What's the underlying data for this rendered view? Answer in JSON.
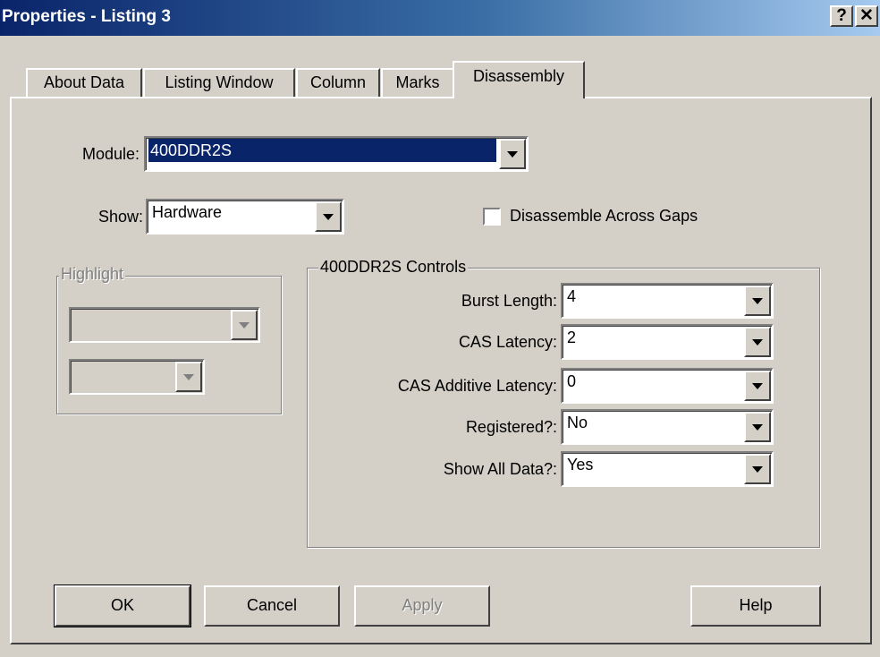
{
  "window": {
    "title": "Properties - Listing 3",
    "help_caption": "?",
    "close_caption": "✕"
  },
  "tabs": [
    {
      "label": "About Data",
      "selected": false
    },
    {
      "label": "Listing Window",
      "selected": false
    },
    {
      "label": "Column",
      "selected": false
    },
    {
      "label": "Marks",
      "selected": false
    },
    {
      "label": "Disassembly",
      "selected": true
    }
  ],
  "module": {
    "label": "Module:",
    "value": "400DDR2S"
  },
  "show": {
    "label": "Show:",
    "value": "Hardware"
  },
  "disassemble_gaps": {
    "label": "Disassemble Across Gaps",
    "checked": false
  },
  "highlight": {
    "title": "Highlight",
    "select1": "",
    "select2": ""
  },
  "controls": {
    "title": "400DDR2S Controls",
    "fields": [
      {
        "label": "Burst Length:",
        "value": "4"
      },
      {
        "label": "CAS Latency:",
        "value": "2"
      },
      {
        "label": "CAS Additive Latency:",
        "value": "0"
      },
      {
        "label": "Registered?:",
        "value": "No"
      },
      {
        "label": "Show All Data?:",
        "value": "Yes"
      }
    ]
  },
  "buttons": {
    "ok": "OK",
    "cancel": "Cancel",
    "apply": "Apply",
    "help": "Help"
  },
  "colors": {
    "title_start": "#0a246a",
    "title_end": "#a6caf0",
    "face": "#d4d0c8",
    "selection": "#0a246a"
  }
}
